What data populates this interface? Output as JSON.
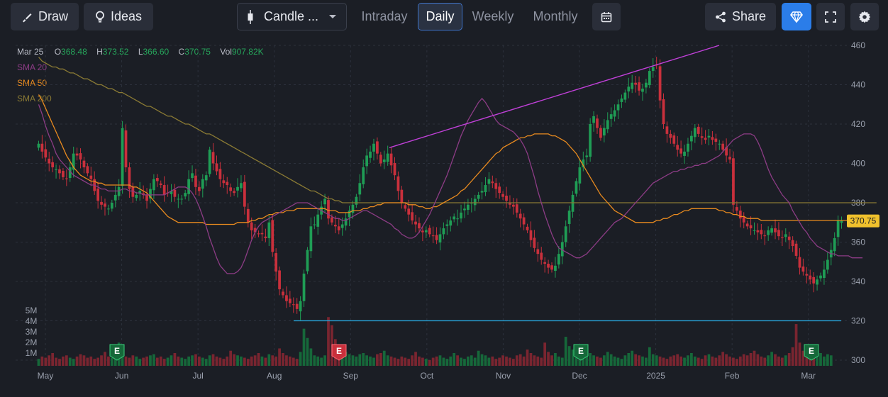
{
  "toolbar": {
    "draw_label": "Draw",
    "ideas_label": "Ideas",
    "chart_type_label": "Candle ...",
    "tabs": [
      "Intraday",
      "Daily",
      "Weekly",
      "Monthly"
    ],
    "active_tab": "Daily",
    "share_label": "Share",
    "accent_color": "#2b7de9"
  },
  "legend": {
    "date": "Mar 25",
    "open_label": "O",
    "open": "368.48",
    "high_label": "H",
    "high": "373.52",
    "low_label": "L",
    "low": "366.60",
    "close_label": "C",
    "close": "370.75",
    "vol_label": "Vol",
    "vol": "907.82K",
    "sma": [
      {
        "label": "SMA 20",
        "color": "#8c3c85"
      },
      {
        "label": "SMA 50",
        "color": "#e88a1f"
      },
      {
        "label": "SMA 200",
        "color": "#8a7a34"
      }
    ]
  },
  "chart_data": {
    "type": "candlestick",
    "last_price_label": "370.75",
    "ylim": [
      300,
      460
    ],
    "price_ticks": [
      460,
      440,
      420,
      400,
      380,
      360,
      340,
      320,
      300
    ],
    "volume_ticks": [
      "5M",
      "4M",
      "3M",
      "2M",
      "1M"
    ],
    "volume_ylim": [
      0,
      5.5
    ],
    "month_labels": [
      "May",
      "Jun",
      "Jul",
      "Aug",
      "Sep",
      "Oct",
      "Nov",
      "Dec",
      "2025",
      "Feb",
      "Mar"
    ],
    "earnings_markers": [
      {
        "label": "E",
        "month": "Jun",
        "style": "green"
      },
      {
        "label": "E",
        "month": "Sep",
        "style": "red"
      },
      {
        "label": "E",
        "month": "Dec",
        "style": "green"
      },
      {
        "label": "E",
        "month": "Mar",
        "style": "green"
      }
    ],
    "trendline": {
      "from": [
        408,
        "Sep"
      ],
      "to": [
        460,
        "Jan"
      ],
      "color": "#c040d8"
    },
    "support_line": {
      "value": 320,
      "color": "#29a8e0"
    },
    "price_path": [
      410,
      406,
      403,
      400,
      398,
      397,
      395,
      393,
      392,
      398,
      405,
      404,
      402,
      398,
      395,
      392,
      386,
      381,
      379,
      378,
      377,
      380,
      384,
      388,
      418,
      398,
      387,
      383,
      384,
      386,
      384,
      381,
      387,
      392,
      391,
      389,
      384,
      385,
      386,
      383,
      382,
      382,
      385,
      392,
      395,
      388,
      386,
      392,
      394,
      407,
      400,
      396,
      392,
      390,
      389,
      386,
      385,
      388,
      390,
      378,
      370,
      366,
      365,
      364,
      364,
      362,
      370,
      355,
      345,
      336,
      333,
      330,
      329,
      328,
      326,
      330,
      344,
      356,
      368,
      369,
      374,
      378,
      382,
      372,
      370,
      368,
      366,
      369,
      372,
      376,
      379,
      383,
      390,
      398,
      404,
      406,
      410,
      405,
      400,
      402,
      405,
      399,
      394,
      386,
      380,
      377,
      374,
      371,
      369,
      367,
      365,
      366,
      364,
      363,
      361,
      364,
      367,
      369,
      371,
      373,
      372,
      375,
      377,
      379,
      380,
      382,
      384,
      386,
      389,
      392,
      390,
      387,
      385,
      383,
      381,
      379,
      378,
      375,
      372,
      369,
      366,
      361,
      357,
      354,
      351,
      349,
      347,
      346,
      348,
      354,
      360,
      368,
      376,
      384,
      391,
      398,
      402,
      404,
      420,
      424,
      418,
      413,
      418,
      422,
      425,
      427,
      430,
      433,
      436,
      439,
      441,
      440,
      437,
      438,
      441,
      447,
      449,
      450,
      432,
      420,
      415,
      413,
      410,
      407,
      405,
      406,
      410,
      414,
      418,
      415,
      413,
      412,
      414,
      412,
      411,
      410,
      407,
      404,
      402,
      379,
      376,
      372,
      370,
      368,
      367,
      366,
      365,
      364,
      363,
      366,
      367,
      365,
      363,
      362,
      364,
      361,
      358,
      353,
      347,
      345,
      343,
      341,
      339,
      341,
      343,
      346,
      351,
      356,
      362,
      371,
      371
    ],
    "sma20": [
      430,
      425,
      419,
      414,
      410,
      405,
      402,
      400,
      398,
      396,
      394,
      393,
      392,
      391,
      390,
      389,
      389,
      388,
      387,
      387,
      386,
      386,
      386,
      386,
      387,
      387,
      386,
      386,
      385,
      385,
      384,
      384,
      384,
      384,
      384,
      384,
      384,
      385,
      386,
      387,
      388,
      388,
      388,
      387,
      385,
      382,
      378,
      373,
      368,
      362,
      357,
      352,
      348,
      346,
      344,
      344,
      344,
      345,
      347,
      351,
      356,
      361,
      365,
      368,
      370,
      371,
      372,
      373,
      374,
      375,
      376,
      377,
      378,
      379,
      380,
      380,
      380,
      380,
      379,
      378,
      377,
      376,
      375,
      374,
      373,
      372,
      372,
      371,
      371,
      372,
      373,
      374,
      375,
      376,
      376,
      375,
      374,
      373,
      372,
      371,
      370,
      369,
      367,
      366,
      364,
      363,
      362,
      362,
      363,
      365,
      368,
      371,
      374,
      378,
      382,
      386,
      390,
      394,
      399,
      404,
      409,
      414,
      418,
      422,
      425,
      428,
      431,
      433,
      431,
      428,
      425,
      422,
      420,
      419,
      418,
      417,
      416,
      414,
      412,
      409,
      405,
      399,
      393,
      386,
      380,
      374,
      369,
      364,
      360,
      357,
      356,
      355,
      354,
      353,
      352,
      352,
      353,
      354,
      356,
      358,
      360,
      362,
      364,
      366,
      368,
      370,
      371,
      372,
      374,
      376,
      378,
      380,
      382,
      384,
      386,
      388,
      390,
      391,
      392,
      393,
      394,
      395,
      396,
      396,
      397,
      397,
      398,
      398,
      399,
      399,
      400,
      400,
      401,
      402,
      403,
      404,
      406,
      408,
      410,
      412,
      413,
      414,
      415,
      415,
      415,
      414,
      411,
      407,
      402,
      397,
      393,
      390,
      387,
      384,
      382,
      380,
      376,
      373,
      370,
      367,
      365,
      362,
      360,
      358,
      357,
      356,
      355,
      354,
      354,
      353,
      353,
      353,
      353,
      352,
      352,
      352,
      352
    ],
    "sma50": [
      435,
      432,
      428,
      424,
      420,
      416,
      412,
      408,
      404,
      401,
      398,
      396,
      394,
      393,
      392,
      391,
      391,
      390,
      390,
      389,
      389,
      389,
      389,
      389,
      389,
      389,
      389,
      388,
      388,
      387,
      386,
      385,
      383,
      381,
      379,
      377,
      375,
      373,
      372,
      371,
      370,
      370,
      370,
      370,
      370,
      370,
      370,
      370,
      369,
      369,
      369,
      369,
      369,
      369,
      369,
      369,
      369,
      370,
      370,
      370,
      370,
      371,
      371,
      372,
      372,
      373,
      374,
      374,
      375,
      375,
      375,
      376,
      376,
      376,
      377,
      377,
      377,
      377,
      377,
      377,
      377,
      377,
      377,
      376,
      376,
      376,
      375,
      375,
      375,
      375,
      376,
      376,
      376,
      377,
      377,
      378,
      378,
      379,
      379,
      380,
      380,
      380,
      380,
      380,
      380,
      380,
      379,
      379,
      379,
      378,
      378,
      377,
      377,
      378,
      378,
      379,
      380,
      381,
      382,
      383,
      384,
      386,
      387,
      389,
      391,
      393,
      395,
      397,
      399,
      401,
      403,
      405,
      406,
      408,
      409,
      410,
      411,
      412,
      413,
      413,
      414,
      414,
      415,
      415,
      415,
      415,
      415,
      414,
      414,
      413,
      412,
      411,
      409,
      407,
      405,
      402,
      399,
      396,
      393,
      390,
      387,
      384,
      382,
      380,
      378,
      376,
      375,
      374,
      373,
      372,
      371,
      370,
      370,
      370,
      370,
      370,
      370,
      371,
      371,
      372,
      372,
      373,
      374,
      374,
      375,
      376,
      376,
      377,
      377,
      377,
      377,
      377,
      377,
      377,
      377,
      376,
      376,
      375,
      375,
      374,
      374,
      373,
      373,
      372,
      372,
      372,
      372,
      371,
      371,
      371,
      371,
      371,
      371,
      371,
      371,
      371,
      371,
      371,
      371,
      371,
      371,
      371,
      371,
      371,
      371,
      371,
      371,
      371,
      371,
      371,
      371,
      371,
      371,
      371,
      371,
      371,
      371,
      371,
      371,
      371,
      371
    ],
    "sma200": [
      454,
      452,
      451,
      450,
      449,
      449,
      448,
      448,
      447,
      446,
      446,
      445,
      444,
      443,
      443,
      442,
      441,
      440,
      440,
      439,
      438,
      438,
      437,
      436,
      436,
      435,
      434,
      433,
      432,
      431,
      430,
      429,
      429,
      428,
      427,
      426,
      425,
      424,
      424,
      423,
      422,
      421,
      420,
      420,
      419,
      418,
      417,
      416,
      415,
      415,
      414,
      413,
      412,
      411,
      410,
      409,
      408,
      407,
      406,
      405,
      404,
      403,
      402,
      401,
      400,
      399,
      398,
      397,
      396,
      395,
      394,
      393,
      392,
      391,
      390,
      389,
      388,
      387,
      386,
      386,
      385,
      384,
      383,
      382,
      382,
      381,
      381,
      380,
      380,
      380,
      380,
      380,
      380,
      380,
      380,
      380,
      380,
      380,
      380,
      380,
      380,
      380,
      380,
      380,
      380,
      380,
      380,
      380,
      380,
      380,
      380,
      380,
      380,
      380,
      380,
      380,
      380,
      380,
      380,
      380,
      380,
      380,
      380,
      380,
      380,
      380,
      380,
      380,
      380,
      380,
      380,
      380,
      380,
      380,
      380,
      380,
      380,
      380,
      380,
      380,
      380,
      380,
      380,
      380,
      380,
      380,
      380,
      380,
      380,
      380,
      380,
      380,
      380,
      380,
      380,
      380,
      380,
      380,
      380,
      380,
      380,
      380,
      380,
      380,
      380,
      380,
      380,
      380,
      380,
      380,
      380,
      380,
      380,
      380,
      380,
      380,
      380,
      380,
      380,
      380,
      380,
      380,
      380,
      380,
      380,
      380,
      380,
      380,
      380,
      380,
      380,
      380,
      380,
      380,
      380,
      380,
      380,
      380,
      380,
      380,
      380,
      380,
      380,
      380,
      380,
      380,
      380,
      380,
      380,
      380,
      380,
      380,
      380,
      380,
      380,
      380,
      380,
      380,
      380,
      380,
      380,
      380,
      380,
      380,
      380,
      380,
      380,
      380,
      380,
      380,
      380,
      380,
      380,
      380,
      380,
      380,
      380,
      380,
      380,
      380,
      380
    ],
    "volume": [
      0.6,
      0.8,
      0.7,
      0.9,
      1.1,
      0.7,
      0.6,
      0.8,
      0.9,
      0.7,
      0.6,
      0.8,
      1.0,
      0.9,
      0.7,
      0.8,
      0.6,
      0.7,
      0.9,
      1.2,
      0.8,
      0.7,
      1.3,
      2.0,
      1.1,
      0.8,
      0.7,
      0.9,
      0.8,
      0.6,
      0.7,
      0.8,
      0.9,
      1.0,
      0.7,
      0.8,
      0.6,
      0.7,
      0.9,
      1.1,
      0.8,
      0.7,
      0.6,
      0.8,
      0.9,
      1.0,
      0.8,
      0.7,
      0.6,
      0.9,
      1.0,
      0.8,
      0.7,
      0.6,
      0.8,
      1.3,
      1.0,
      0.9,
      0.8,
      0.7,
      0.6,
      0.8,
      0.9,
      1.1,
      0.8,
      0.7,
      1.0,
      0.9,
      0.8,
      1.5,
      1.1,
      0.9,
      0.8,
      0.7,
      0.6,
      1.2,
      3.2,
      2.4,
      1.5,
      0.9,
      0.8,
      0.7,
      0.9,
      4.2,
      3.5,
      2.3,
      1.8,
      1.5,
      1.2,
      1.0,
      0.9,
      0.8,
      1.0,
      1.1,
      0.9,
      0.8,
      0.7,
      1.0,
      1.1,
      1.3,
      0.9,
      0.8,
      0.7,
      0.6,
      0.8,
      0.7,
      0.6,
      0.9,
      1.2,
      0.8,
      0.7,
      0.6,
      0.5,
      0.7,
      0.8,
      0.9,
      0.7,
      0.6,
      0.8,
      1.1,
      0.9,
      0.7,
      0.6,
      0.8,
      0.9,
      0.7,
      1.3,
      1.0,
      0.9,
      0.7,
      0.8,
      0.6,
      0.7,
      0.9,
      0.8,
      0.7,
      0.6,
      0.9,
      1.0,
      0.8,
      1.4,
      1.1,
      0.9,
      0.8,
      0.7,
      2.0,
      1.2,
      0.9,
      1.1,
      0.8,
      0.7,
      2.5,
      1.7,
      1.4,
      1.1,
      1.0,
      0.9,
      0.8,
      1.1,
      0.9,
      0.8,
      0.7,
      0.9,
      1.2,
      1.0,
      0.8,
      0.7,
      0.6,
      0.9,
      1.1,
      1.3,
      1.0,
      0.9,
      0.8,
      0.7,
      1.6,
      1.0,
      0.9,
      0.8,
      0.7,
      0.6,
      0.8,
      0.9,
      1.0,
      0.8,
      0.7,
      0.9,
      1.1,
      0.8,
      0.7,
      0.6,
      0.9,
      1.0,
      0.8,
      0.7,
      0.9,
      1.2,
      1.0,
      0.8,
      0.7,
      0.6,
      0.8,
      1.0,
      0.9,
      1.1,
      1.3,
      1.0,
      0.8,
      0.7,
      0.9,
      1.2,
      1.0,
      0.8,
      0.7,
      0.9,
      1.1,
      1.6,
      3.6,
      2.0,
      1.3,
      1.0,
      0.8,
      0.7,
      0.9,
      1.1,
      0.8,
      1.0,
      0.9
    ]
  }
}
